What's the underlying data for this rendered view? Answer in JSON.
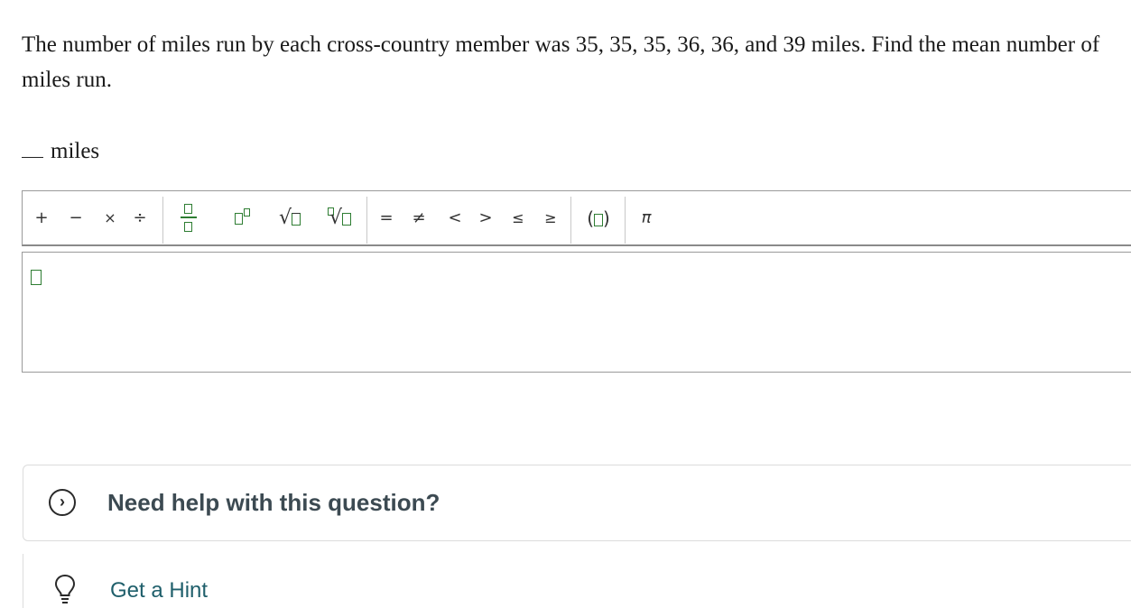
{
  "question": {
    "text": "The number of miles run by each cross-country member was 35, 35, 35, 36, 36, and 39 miles. Find the mean number of miles run."
  },
  "answer": {
    "unit": "miles"
  },
  "toolbar": {
    "plus": "+",
    "minus": "−",
    "times": "×",
    "divide": "÷",
    "equals": "=",
    "not_equal": "≠",
    "less_than": "<",
    "greater_than": ">",
    "less_equal": "≤",
    "greater_equal": "≥",
    "paren_open": "(",
    "paren_close": ")",
    "pi": "π",
    "sqrt_symbol": "√",
    "nth_root_symbol": "√"
  },
  "help": {
    "title": "Need help with this question?",
    "chevron": "›"
  },
  "hint": {
    "label": "Get a Hint"
  },
  "colors": {
    "accent_green": "#2e7d32",
    "help_title": "#3c4a52",
    "hint_link": "#1f5f6b"
  }
}
